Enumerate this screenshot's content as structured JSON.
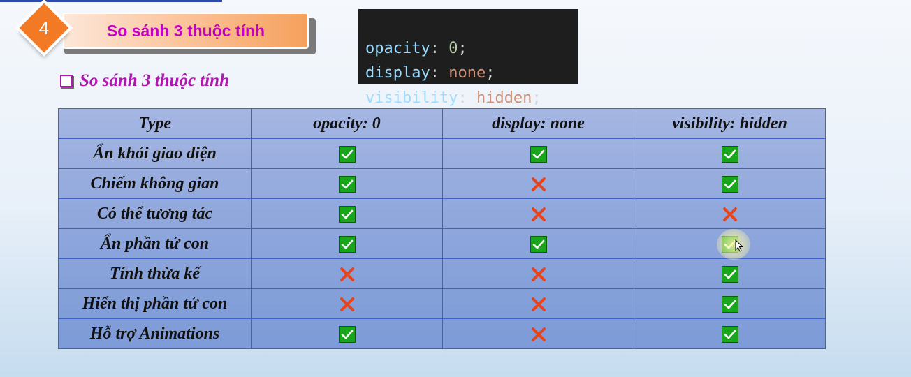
{
  "section": {
    "number": "4",
    "title": "So sánh 3 thuộc tính",
    "accent_color": "#f27a24",
    "title_color": "#c400c4"
  },
  "code": {
    "lines": [
      {
        "prop": "opacity",
        "value": "0",
        "value_type": "number"
      },
      {
        "prop": "display",
        "value": "none",
        "value_type": "keyword"
      },
      {
        "prop": "visibility",
        "value": "hidden",
        "value_type": "keyword"
      }
    ]
  },
  "subheading": {
    "text": "So sánh 3 thuộc tính",
    "color": "#b015b0"
  },
  "table": {
    "headers": [
      "Type",
      "opacity: 0",
      "display: none",
      "visibility: hidden"
    ],
    "rows": [
      {
        "label": "Ẩn khỏi giao diện",
        "values": [
          "check",
          "check",
          "check"
        ]
      },
      {
        "label": "Chiếm không gian",
        "values": [
          "check",
          "cross",
          "check"
        ]
      },
      {
        "label": "Có thể tương tác",
        "values": [
          "check",
          "cross",
          "cross"
        ]
      },
      {
        "label": "Ẩn phần tử con",
        "values": [
          "check",
          "check",
          "check"
        ]
      },
      {
        "label": "Tính thừa kế",
        "values": [
          "cross",
          "cross",
          "check"
        ]
      },
      {
        "label": "Hiển thị phần tử con",
        "values": [
          "cross",
          "cross",
          "check"
        ]
      },
      {
        "label": "Hỗ trợ Animations",
        "values": [
          "check",
          "cross",
          "check"
        ]
      }
    ],
    "check_color": "#1aa61a",
    "cross_color": "#e8441c"
  }
}
